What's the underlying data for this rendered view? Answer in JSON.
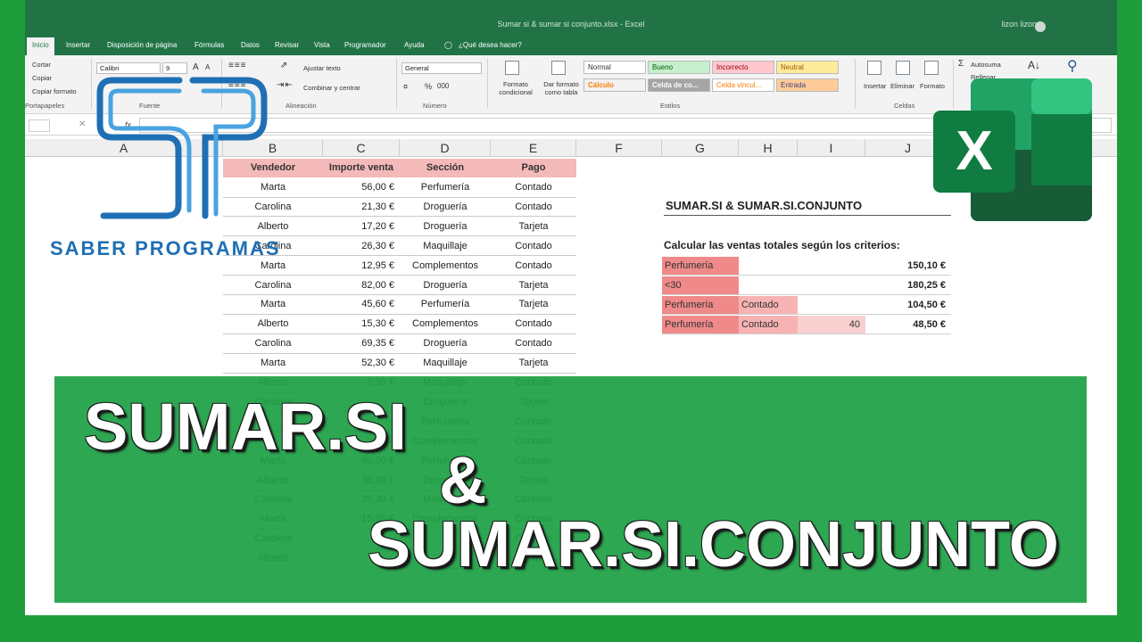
{
  "window": {
    "title": "Sumar si & sumar si conjunto.xlsx - Excel",
    "user": "lizon lizon"
  },
  "tabs": [
    "Inicio",
    "Insertar",
    "Disposición de página",
    "Fórmulas",
    "Datos",
    "Revisar",
    "Vista",
    "Programador",
    "Ayuda",
    "¿Qué desea hacer?"
  ],
  "ribbon": {
    "clipboard": {
      "cut": "Cortar",
      "copy": "Copiar",
      "format_painter": "Copiar formato",
      "group": "Portapapeles"
    },
    "font": {
      "name": "Calibri",
      "size": "9",
      "group": "Fuente"
    },
    "alignment": {
      "wrap": "Ajustar texto",
      "merge": "Combinar y centrar",
      "group": "Alineación"
    },
    "number": {
      "format": "General",
      "percent": "%",
      "thousands": "000",
      "group": "Número"
    },
    "styles": {
      "conditional": "Formato condicional",
      "as_table": "Dar formato como tabla",
      "cells": [
        "Normal",
        "Bueno",
        "Incorrecto",
        "Neutral",
        "Cálculo",
        "Celda de co...",
        "Celda vincul...",
        "Entrada"
      ],
      "group": "Estilos"
    },
    "cells": {
      "insert": "Insertar",
      "delete": "Eliminar",
      "format": "Formato",
      "group": "Celdas"
    },
    "editing": {
      "autosum": "Autosuma",
      "fill": "Rellenar"
    }
  },
  "formula_bar": {
    "fx": "fx"
  },
  "columns": [
    "A",
    "B",
    "C",
    "D",
    "E",
    "F",
    "G",
    "H",
    "I",
    "J"
  ],
  "table": {
    "headers": [
      "Vendedor",
      "Importe venta",
      "Sección",
      "Pago"
    ],
    "rows": [
      [
        "Marta",
        "56,00 €",
        "Perfumería",
        "Contado"
      ],
      [
        "Carolina",
        "21,30 €",
        "Droguería",
        "Contado"
      ],
      [
        "Alberto",
        "17,20 €",
        "Droguería",
        "Tarjeta"
      ],
      [
        "Carolina",
        "26,30 €",
        "Maquillaje",
        "Contado"
      ],
      [
        "Marta",
        "12,95 €",
        "Complementos",
        "Contado"
      ],
      [
        "Carolina",
        "82,00 €",
        "Droguería",
        "Tarjeta"
      ],
      [
        "Marta",
        "45,60 €",
        "Perfumería",
        "Tarjeta"
      ],
      [
        "Alberto",
        "15,30 €",
        "Complementos",
        "Contado"
      ],
      [
        "Carolina",
        "69,35 €",
        "Droguería",
        "Contado"
      ],
      [
        "Marta",
        "52,30 €",
        "Maquillaje",
        "Tarjeta"
      ],
      [
        "Alberto",
        "9,95 €",
        "Maquillaje",
        "Contado"
      ],
      [
        "Carolina",
        "",
        "Droguería",
        "Tarjeta"
      ],
      [
        "",
        "",
        "Perfumería",
        "Contado"
      ],
      [
        "",
        "",
        "Complementos",
        "Contado"
      ],
      [
        "Marta",
        "40,00 €",
        "Perfumería",
        "Contado"
      ],
      [
        "Alberto",
        "36,90 €",
        "Droguería",
        "Tarjeta"
      ],
      [
        "Carolina",
        "35,30 €",
        "Maquillaje",
        "Contado"
      ],
      [
        "Marta",
        "15,95 €",
        "Complementos",
        "Contado"
      ],
      [
        "Carolina",
        "",
        "",
        "Contado"
      ],
      [
        "Alberto",
        "",
        "",
        "Contado"
      ]
    ]
  },
  "summary": {
    "title": "SUMAR.SI  &  SUMAR.SI.CONJUNTO",
    "subtitle": "Calcular las ventas totales según los criterios:",
    "rows": [
      {
        "g": "Perfumería",
        "h": "",
        "i": "",
        "j": "150,10 €"
      },
      {
        "g": "<30",
        "h": "",
        "i": "",
        "j": "180,25 €"
      },
      {
        "g": "Perfumería",
        "h": "Contado",
        "i": "",
        "j": "104,50 €"
      },
      {
        "g": "Perfumería",
        "h": "Contado",
        "i": "40",
        "j": "48,50 €"
      }
    ]
  },
  "overlay": {
    "line1": "SUMAR.SI",
    "amp": "&",
    "line2": "SUMAR.SI.CONJUNTO",
    "brand": "SABER PROGRAMAS",
    "excel_letter": "X"
  },
  "colors": {
    "excel_green": "#217346",
    "banner_green": "#1ea046",
    "header_pink": "#f4b9b9",
    "criteria_red": "#f08a8a",
    "criteria_light": "#f8c8c8",
    "brand_blue": "#1f6fb4"
  }
}
